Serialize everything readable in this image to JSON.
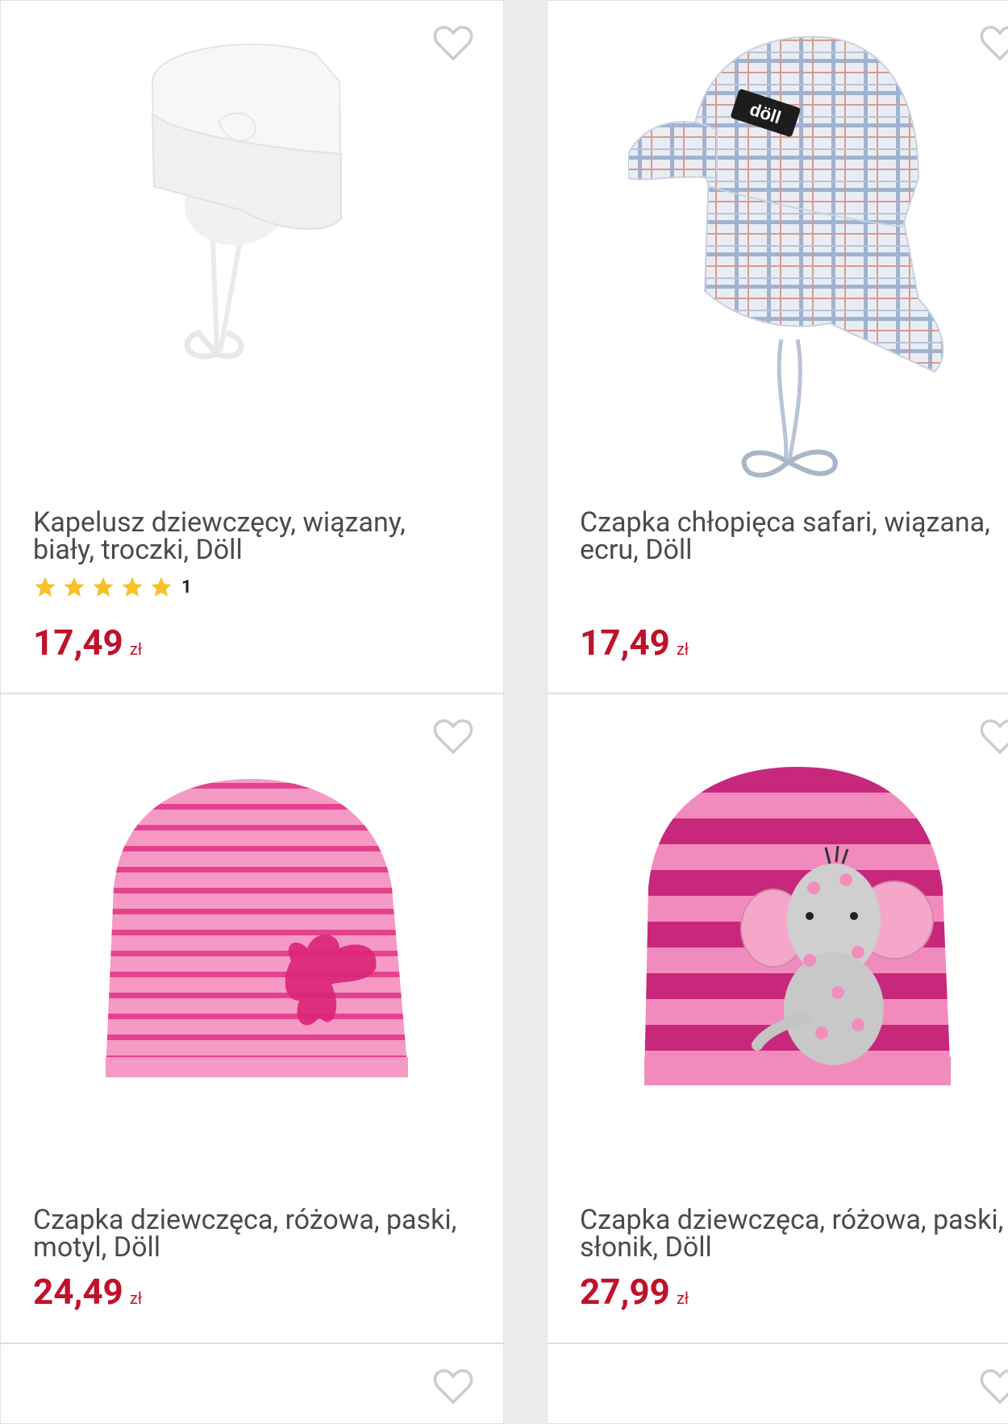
{
  "products": [
    {
      "title": "Kapelusz dziewczęcy, wiązany,\nbiały, troczki, Döll",
      "rating_count": "1",
      "price": "17,49",
      "currency": "zł",
      "favorite_icon": "heart-outline-icon",
      "image": "white baby hat"
    },
    {
      "title": "Czapka chłopięca safari, wiązana,\necru, Döll",
      "price": "17,49",
      "currency": "zł",
      "favorite_icon": "heart-outline-icon",
      "image": "checked safari cap",
      "brand_badge": "döll"
    },
    {
      "title": "Czapka dziewczęca, różowa, paski,\nmotyl, Döll",
      "price": "24,49",
      "currency": "zł",
      "favorite_icon": "heart-outline-icon",
      "image": "pink striped beanie with butterfly"
    },
    {
      "title": "Czapka dziewczęca, różowa, paski,\nsłonik, Döll",
      "price": "27,99",
      "currency": "zł",
      "favorite_icon": "heart-outline-icon",
      "image": "pink striped beanie with elephant"
    }
  ],
  "rating": {
    "stars": 5,
    "color": "#f6c12b"
  },
  "colors": {
    "price": "#c0112b",
    "text": "#4a4a4a",
    "heart": "#cccccc"
  }
}
